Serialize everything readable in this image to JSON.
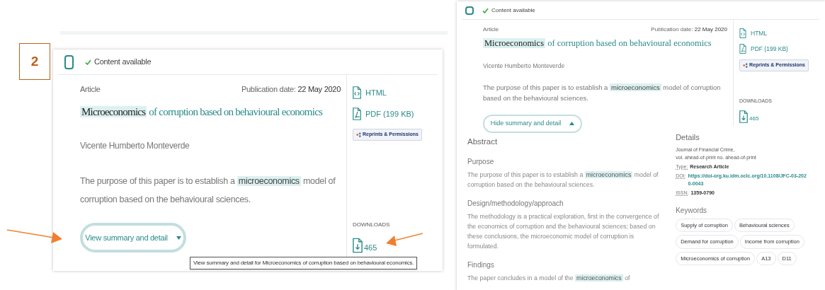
{
  "step_label": "2",
  "collapsed_result": {
    "selected": false,
    "availability": "Content available",
    "type": "Article",
    "date_label": "Publication date:",
    "date": "22 May 2020",
    "title": [
      {
        "text": "Microeconomics",
        "highlighted": true
      },
      {
        "text": "of corruption based on behavioural economics",
        "highlighted": false
      }
    ],
    "author": "Vicente Humberto Monteverde",
    "summary": [
      {
        "text": "The purpose of this paper is to establish a",
        "highlighted": false
      },
      {
        "text": "microeconomics",
        "highlighted": true
      },
      {
        "text": "model of corruption based on the behavioural sciences.",
        "highlighted": false
      }
    ],
    "links": [
      {
        "kind": "html",
        "label": "HTML"
      },
      {
        "kind": "pdf",
        "label": "PDF (199 KB)"
      }
    ],
    "reprints": "Reprints & Permissions",
    "downloads_label": "DOWNLOADS",
    "downloads": "465",
    "toggle": {
      "label": "View summary and detail",
      "expanded": false
    },
    "tooltip": "View summary and detail for Microeconomics of corruption based on behavioural economics."
  },
  "expanded_result": {
    "selected": false,
    "availability": "Content available",
    "type": "Article",
    "date_label": "Publication date:",
    "date": "22 May 2020",
    "title": [
      {
        "text": "Microeconomics",
        "highlighted": true
      },
      {
        "text": "of corruption based on behavioural economics",
        "highlighted": false
      }
    ],
    "author": "Vicente Humberto Monteverde",
    "summary": [
      {
        "text": "The purpose of this paper is to establish a",
        "highlighted": false
      },
      {
        "text": "microeconomics",
        "highlighted": true
      },
      {
        "text": "model of corruption based on the behavioural sciences.",
        "highlighted": false
      }
    ],
    "links": [
      {
        "kind": "html",
        "label": "HTML"
      },
      {
        "kind": "pdf",
        "label": "PDF (199 KB)"
      }
    ],
    "reprints": "Reprints & Permissions",
    "downloads_label": "DOWNLOADS",
    "downloads": "465",
    "toggle": {
      "label": "Hide summary and detail",
      "expanded": true
    },
    "abstract": {
      "heading": "Abstract",
      "sections": [
        {
          "heading": "Purpose",
          "parts": [
            {
              "text": "The purpose of this paper is to establish a",
              "highlighted": false
            },
            {
              "text": "microeconomics",
              "highlighted": true
            },
            {
              "text": "model of corruption based on the behavioural sciences.",
              "highlighted": false
            }
          ]
        },
        {
          "heading": "Design/methodology/approach",
          "parts": [
            {
              "text": "The methodology is a practical exploration, first in the convergence of the economics of corruption and the behavioural sciences; based on these conclusions, the microeconomic model of corruption is formulated.",
              "highlighted": false
            }
          ]
        },
        {
          "heading": "Findings",
          "parts": [
            {
              "text": "The paper concludes in a model of the",
              "highlighted": false
            },
            {
              "text": "microeconomics",
              "highlighted": true
            },
            {
              "text": "of",
              "highlighted": false
            }
          ]
        }
      ]
    },
    "details": {
      "heading": "Details",
      "journal_lines": [
        "Journal of Financial Crime,",
        "vol. ahead-of-print no. ahead-of-print"
      ],
      "fields": [
        {
          "kind": "text",
          "label": "Type:",
          "value": "Research Article"
        },
        {
          "kind": "link",
          "label": "DOI:",
          "value": "https://doi-org.ku.idm.oclc.org/10.1108/JFC-03-2020-0043"
        },
        {
          "kind": "text",
          "label": "ISSN:",
          "value": "1359-0790"
        }
      ]
    },
    "keywords": {
      "heading": "Keywords",
      "items": [
        "Supply of corruption",
        "Behavioural sciences",
        "Demand for corruption",
        "Income from corruption",
        "Microeconomics of corruption",
        "A13",
        "D11"
      ]
    }
  }
}
